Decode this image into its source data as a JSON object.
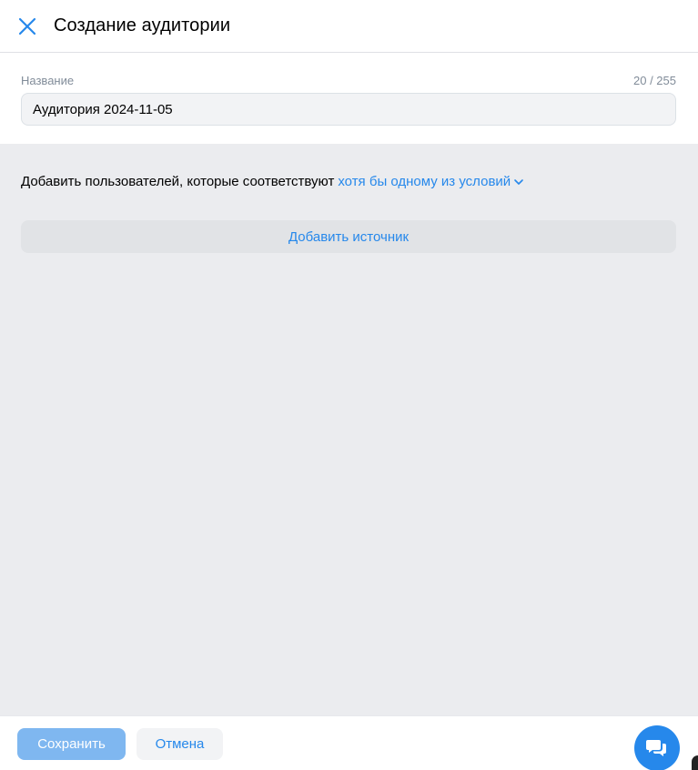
{
  "header": {
    "title": "Создание аудитории",
    "close_icon": "close-icon"
  },
  "name_field": {
    "label": "Название",
    "counter": "20 / 255",
    "value": "Аудитория 2024-11-05"
  },
  "rules": {
    "prefix": "Добавить пользователей, которые соответствуют",
    "condition_link": "хотя бы одному из условий",
    "add_source_label": "Добавить источник"
  },
  "footer": {
    "save_label": "Сохранить",
    "cancel_label": "Отмена",
    "chat_icon": "chat-bubbles-icon"
  },
  "colors": {
    "accent": "#2688eb",
    "save_disabled": "#7fb7f0",
    "section_bg": "#ebecef",
    "input_bg": "#f2f3f5",
    "secondary_text": "#818c99"
  }
}
